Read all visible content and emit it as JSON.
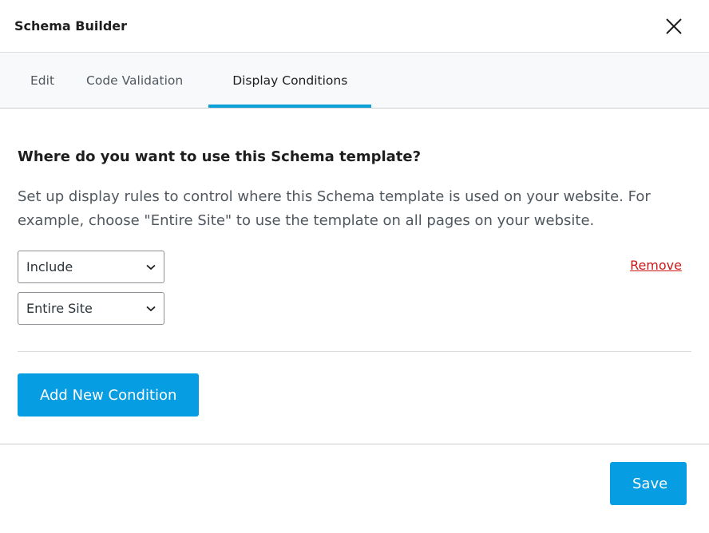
{
  "header": {
    "title": "Schema Builder"
  },
  "tabs": [
    {
      "label": "Edit"
    },
    {
      "label": "Code Validation"
    },
    {
      "label": "Display Conditions",
      "active": true
    }
  ],
  "main": {
    "heading": "Where do you want to use this Schema template?",
    "description": "Set up display rules to control where this Schema template is used on your website. For example, choose \"Entire Site\" to use the template on all pages on your website.",
    "condition": {
      "type": "Include",
      "location": "Entire Site",
      "remove_label": "Remove"
    },
    "add_label": "Add New Condition"
  },
  "footer": {
    "save_label": "Save"
  },
  "colors": {
    "accent": "#069de3",
    "remove": "#cc1818"
  }
}
